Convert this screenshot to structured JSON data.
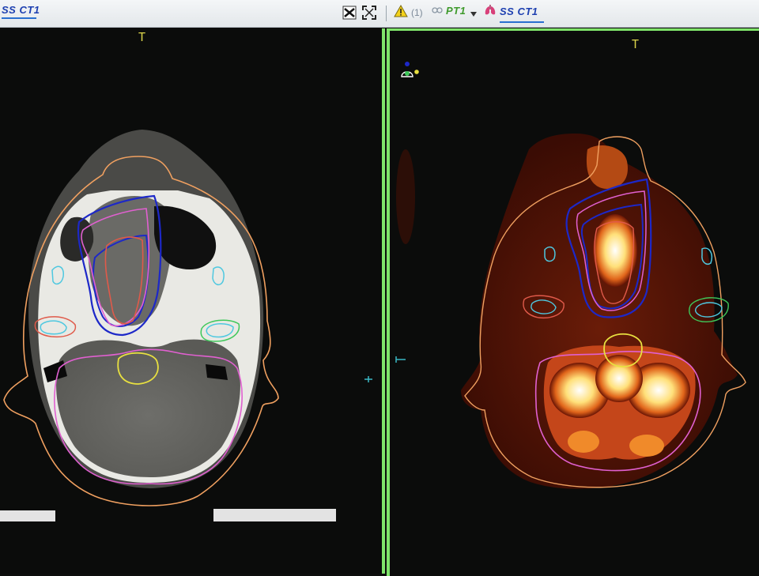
{
  "toolbar": {
    "left_label": "SS CT1",
    "warning_count": "(1)",
    "pet_label": "PT1",
    "right_label": "SS CT1"
  },
  "viewports": {
    "left": {
      "orientation_top": "T"
    },
    "right": {
      "orientation_top": "T"
    }
  },
  "colors": {
    "viewport_border": "#7fe36a",
    "skin_contour": "#f0a060",
    "tumor_outer": "#1d28c8",
    "tumor_inner": "#e060d0",
    "gtv": "#e05a4a",
    "brainstem": "#e8e040",
    "brain": "#e060d0",
    "parotid": "#4ec8e0",
    "cochlea_right": "#3fc85a"
  },
  "icons": [
    "fit-to-window-icon",
    "fullscreen-icon",
    "warning-icon",
    "pet-link-icon",
    "dropdown-arrow-icon",
    "lungs-icon",
    "structure-legend-icon",
    "crosshair-marker-icon"
  ]
}
